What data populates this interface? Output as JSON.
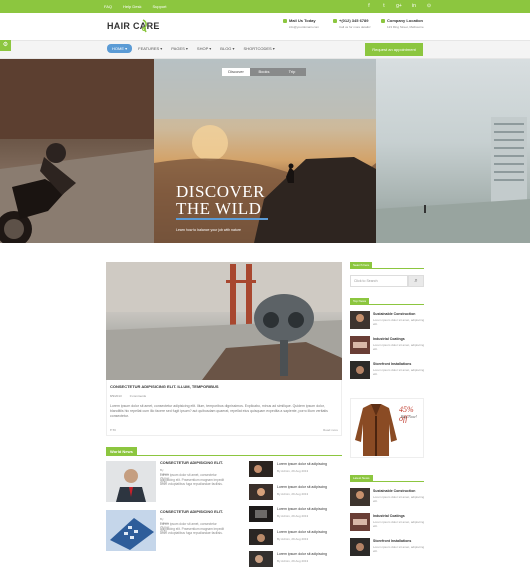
{
  "topbar": {
    "links": [
      "FAQ",
      "Help Desk",
      "Support"
    ],
    "social_icons": [
      "facebook-icon",
      "twitter-icon",
      "google-plus-icon",
      "linkedin-icon",
      "rss-icon"
    ],
    "social_glyphs": [
      "f",
      "t",
      "g+",
      "in",
      "⊙"
    ]
  },
  "header": {
    "logo": "HAIR CARE",
    "contacts": [
      {
        "title": "Mail Us Today",
        "sub": "info@yourdomain.com"
      },
      {
        "title": "+(012) 345 6789",
        "sub": "Call us for more details!"
      },
      {
        "title": "Company Location",
        "sub": "123 Ring Street, Melbourne"
      }
    ]
  },
  "nav": {
    "items": [
      "HOME ▾",
      "FEATURES ▾",
      "PAGES ▾",
      "SHOP ▾",
      "BLOG ▾",
      "SHORTCODES ▾"
    ],
    "appointment": "Request an appointment",
    "side_tab": "⚙"
  },
  "hero": {
    "tabs": [
      "Discover",
      "Books",
      "Trip"
    ],
    "title_line1": "DISCOVER",
    "title_line2": "THE WILD",
    "subtitle": "Learn how to balance your job with nature"
  },
  "featured_post": {
    "title": "CONSECTETUR ADIPISICING ELIT. ILLUM, TEMPORIBUS",
    "date": "8/9/2013",
    "comments": "0 comments",
    "excerpt": "Lorem ipsum dolor sit amet, consectetur adipisicing elit. Illum, temporibus dignissimos. Explicabo, minus ad similique. Quidem ipsum dolor, blanditiis hic repellat cum illo facere sed fugit ipsum? aut quibusdam quaerat, repellat eius quisquam expedita a sapiente, porro illum veritatis consectetur.",
    "likes": "♥ 56",
    "read_more": "Read more"
  },
  "world_news": {
    "heading": "World News",
    "big_items": [
      {
        "title": "CONSECTETUR ADIPISICING ELIT.",
        "meta": "By Admin, 29 Aug 2013",
        "text": "Lorem ipsum dolor sit amet, consectetur adipisicing elit. Praesentium magnam impedit amet voluptatibus fuga repudiandae facilisis."
      },
      {
        "title": "CONSECTETUR ADIPISICING ELIT.",
        "meta": "By Admin, 29 Aug 2013",
        "text": "Lorem ipsum dolor sit amet, consectetur adipisicing elit. Praesentium magnam impedit amet voluptatibus fuga repudiandae facilisis."
      }
    ],
    "small_items": [
      {
        "title": "Lorem ipsum dolor sit adipiscing",
        "meta": "By Admin, 29 Aug 2013"
      },
      {
        "title": "Lorem ipsum dolor sit adipiscing",
        "meta": "By Admin, 29 Aug 2013"
      },
      {
        "title": "Lorem ipsum dolor sit adipiscing",
        "meta": "By Admin, 29 Aug 2013"
      },
      {
        "title": "Lorem ipsum dolor sit adipiscing",
        "meta": "By Admin, 29 Aug 2013"
      },
      {
        "title": "Lorem ipsum dolor sit adipiscing",
        "meta": "By Admin, 29 Aug 2013"
      }
    ]
  },
  "sidebar": {
    "search_heading": "Search here",
    "search_placeholder": "Click to Search",
    "top_heading": "Top News",
    "top_items": [
      {
        "title": "Sustainable Construction",
        "text": "Lorem ipsum dolor sit amet, adipiscing elit."
      },
      {
        "title": "Industrial Coatings",
        "text": "Lorem ipsum dolor sit amet, adipiscing elit."
      },
      {
        "title": "Storefront Installations",
        "text": "Lorem ipsum dolor sit amet, adipiscing elit."
      }
    ],
    "ad_title": "45% off",
    "ad_sub": "Buy Now!",
    "latest_heading": "Latest News",
    "latest_items": [
      {
        "title": "Sustainable Construction",
        "text": "Lorem ipsum dolor sit amet, adipiscing elit."
      },
      {
        "title": "Industrial Coatings",
        "text": "Lorem ipsum dolor sit amet, adipiscing elit."
      },
      {
        "title": "Storefront Installations",
        "text": "Lorem ipsum dolor sit amet, adipiscing elit."
      }
    ]
  },
  "colors": {
    "accent": "#8cc63f",
    "nav_active": "#5b9bd5"
  }
}
